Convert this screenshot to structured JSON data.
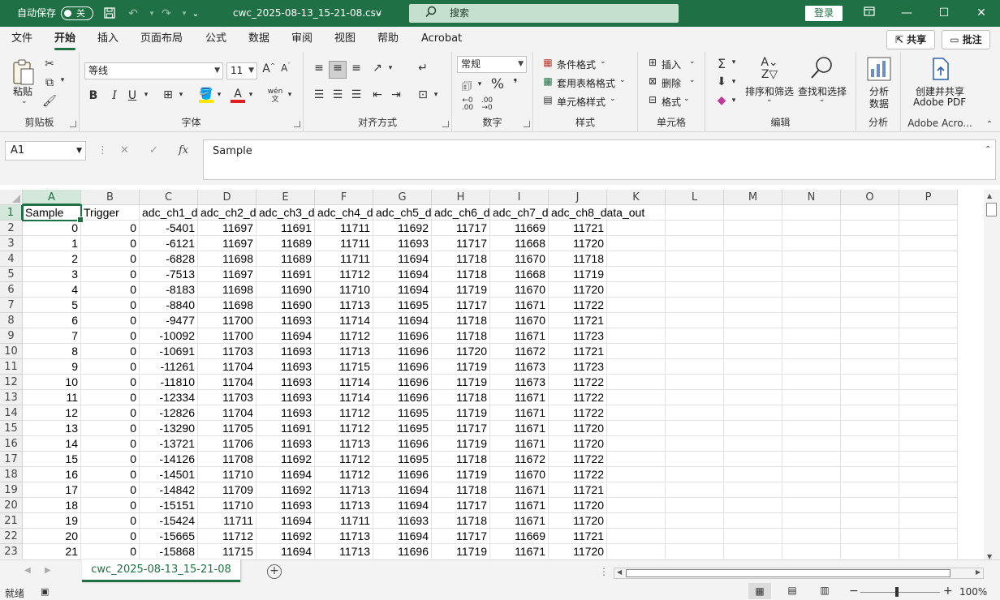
{
  "titlebar": {
    "autosave_label": "自动保存",
    "autosave_state": "关",
    "filename": "cwc_2025-08-13_15-21-08.csv",
    "filename_caret": "⌄",
    "search_placeholder": "搜索",
    "login_label": "登录"
  },
  "menu": {
    "items": [
      "文件",
      "开始",
      "插入",
      "页面布局",
      "公式",
      "数据",
      "审阅",
      "视图",
      "帮助",
      "Acrobat"
    ],
    "active_index": 1,
    "share_label": "共享",
    "comment_label": "批注"
  },
  "ribbon": {
    "clipboard": {
      "paste": "粘贴",
      "label": "剪贴板"
    },
    "font": {
      "name": "等线",
      "size": "11",
      "bold": "B",
      "italic": "I",
      "underline": "U",
      "label": "字体"
    },
    "alignment": {
      "label": "对齐方式"
    },
    "number": {
      "format": "常规",
      "percent": "%",
      "comma": "❜",
      "label": "数字"
    },
    "styles": {
      "conditional": "条件格式",
      "table": "套用表格格式",
      "cell": "单元格样式",
      "label": "样式"
    },
    "cells": {
      "insert": "插入",
      "delete": "删除",
      "format": "格式",
      "label": "单元格"
    },
    "editing": {
      "sort": "排序和筛选",
      "find": "查找和选择",
      "label": "编辑"
    },
    "analysis": {
      "button_line1": "分析",
      "button_line2": "数据",
      "label": "分析"
    },
    "acrobat": {
      "button_line1": "创建并共享",
      "button_line2": "Adobe PDF",
      "label": "Adobe Acro..."
    }
  },
  "formula_bar": {
    "name_box": "A1",
    "content": "Sample"
  },
  "sheet": {
    "columns": [
      "A",
      "B",
      "C",
      "D",
      "E",
      "F",
      "G",
      "H",
      "I",
      "J",
      "K",
      "L",
      "M",
      "N",
      "O",
      "P"
    ],
    "headers": [
      "Sample",
      "Trigger",
      "adc_ch1_d",
      "adc_ch2_d",
      "adc_ch3_d",
      "adc_ch4_d",
      "adc_ch5_d",
      "adc_ch6_d",
      "adc_ch7_d",
      "adc_ch8_data_out"
    ],
    "rows": [
      [
        "0",
        "0",
        "-5401",
        "11697",
        "11691",
        "11711",
        "11692",
        "11717",
        "11669",
        "11721"
      ],
      [
        "1",
        "0",
        "-6121",
        "11697",
        "11689",
        "11711",
        "11693",
        "11717",
        "11668",
        "11720"
      ],
      [
        "2",
        "0",
        "-6828",
        "11698",
        "11689",
        "11711",
        "11694",
        "11718",
        "11670",
        "11718"
      ],
      [
        "3",
        "0",
        "-7513",
        "11697",
        "11691",
        "11712",
        "11694",
        "11718",
        "11668",
        "11719"
      ],
      [
        "4",
        "0",
        "-8183",
        "11698",
        "11690",
        "11710",
        "11694",
        "11719",
        "11670",
        "11720"
      ],
      [
        "5",
        "0",
        "-8840",
        "11698",
        "11690",
        "11713",
        "11695",
        "11717",
        "11671",
        "11722"
      ],
      [
        "6",
        "0",
        "-9477",
        "11700",
        "11693",
        "11714",
        "11694",
        "11718",
        "11670",
        "11721"
      ],
      [
        "7",
        "0",
        "-10092",
        "11700",
        "11694",
        "11712",
        "11696",
        "11718",
        "11671",
        "11723"
      ],
      [
        "8",
        "0",
        "-10691",
        "11703",
        "11693",
        "11713",
        "11696",
        "11720",
        "11672",
        "11721"
      ],
      [
        "9",
        "0",
        "-11261",
        "11704",
        "11693",
        "11715",
        "11696",
        "11719",
        "11673",
        "11723"
      ],
      [
        "10",
        "0",
        "-11810",
        "11704",
        "11693",
        "11714",
        "11696",
        "11719",
        "11673",
        "11722"
      ],
      [
        "11",
        "0",
        "-12334",
        "11703",
        "11693",
        "11714",
        "11696",
        "11718",
        "11671",
        "11722"
      ],
      [
        "12",
        "0",
        "-12826",
        "11704",
        "11693",
        "11712",
        "11695",
        "11719",
        "11671",
        "11722"
      ],
      [
        "13",
        "0",
        "-13290",
        "11705",
        "11691",
        "11712",
        "11695",
        "11717",
        "11671",
        "11720"
      ],
      [
        "14",
        "0",
        "-13721",
        "11706",
        "11693",
        "11713",
        "11696",
        "11719",
        "11671",
        "11720"
      ],
      [
        "15",
        "0",
        "-14126",
        "11708",
        "11692",
        "11712",
        "11695",
        "11718",
        "11672",
        "11722"
      ],
      [
        "16",
        "0",
        "-14501",
        "11710",
        "11694",
        "11712",
        "11696",
        "11719",
        "11670",
        "11722"
      ],
      [
        "17",
        "0",
        "-14842",
        "11709",
        "11692",
        "11713",
        "11694",
        "11718",
        "11671",
        "11721"
      ],
      [
        "18",
        "0",
        "-15151",
        "11710",
        "11693",
        "11713",
        "11694",
        "11717",
        "11671",
        "11720"
      ],
      [
        "19",
        "0",
        "-15424",
        "11711",
        "11694",
        "11711",
        "11693",
        "11718",
        "11671",
        "11720"
      ],
      [
        "20",
        "0",
        "-15665",
        "11712",
        "11692",
        "11713",
        "11694",
        "11717",
        "11669",
        "11721"
      ],
      [
        "21",
        "0",
        "-15868",
        "11715",
        "11694",
        "11713",
        "11696",
        "11719",
        "11671",
        "11720"
      ]
    ]
  },
  "tabs": {
    "sheet_name": "cwc_2025-08-13_15-21-08",
    "add_label": "+"
  },
  "status": {
    "ready": "就绪",
    "zoom": "100%",
    "zoom_minus": "−",
    "zoom_plus": "+"
  },
  "colors": {
    "accent": "#1f7145",
    "selected_header": "#d3e8da",
    "chrome": "#f3f3f3"
  }
}
